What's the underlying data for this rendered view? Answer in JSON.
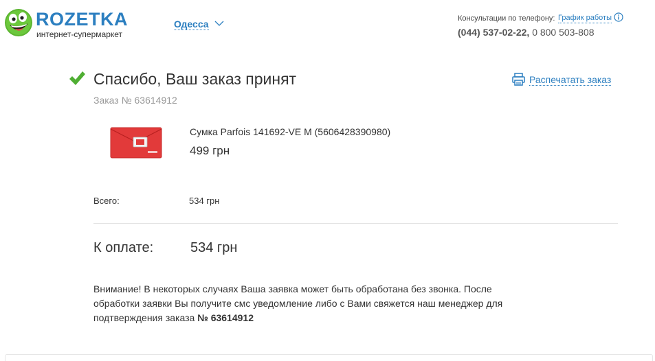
{
  "header": {
    "logo_title": "ROZETKA",
    "logo_subtitle": "интернет-супермаркет",
    "city": "Одесса",
    "consult_label": "Консультации по телефону:",
    "schedule_link": "График работы",
    "phone_main": "(044) 537-02-22,",
    "phone_alt": "0 800 503-808"
  },
  "order": {
    "title": "Спасибо, Ваш заказ принят",
    "order_number": "Заказ № 63614912",
    "print_label": "Распечатать заказ"
  },
  "product": {
    "name": "Сумка Parfois 141692-VE M (5606428390980)",
    "price": "499 грн"
  },
  "totals": {
    "total_label": "Всего:",
    "total_value": "534 грн",
    "pay_label": "К оплате:",
    "pay_value": "534 грн"
  },
  "notice": {
    "text": "Внимание! В некоторых случаях Ваша заявка может быть обработана без звонка. После обработки заявки Вы получите смс уведомление либо с Вами свяжется наш менеджер для подтверждения заказа ",
    "bold": "№ 63614912"
  },
  "icons": {
    "logo": "rozetka-smiley-logo",
    "city_chevron": "chevron-down-icon",
    "info": "info-icon",
    "check": "check-icon",
    "print": "printer-icon",
    "product_image": "red-clutch-bag"
  },
  "colors": {
    "link": "#2c7fc0",
    "logo_green": "#5cb531",
    "check_green": "#4fae33",
    "muted": "#999999",
    "product_red": "#e23a3a"
  }
}
